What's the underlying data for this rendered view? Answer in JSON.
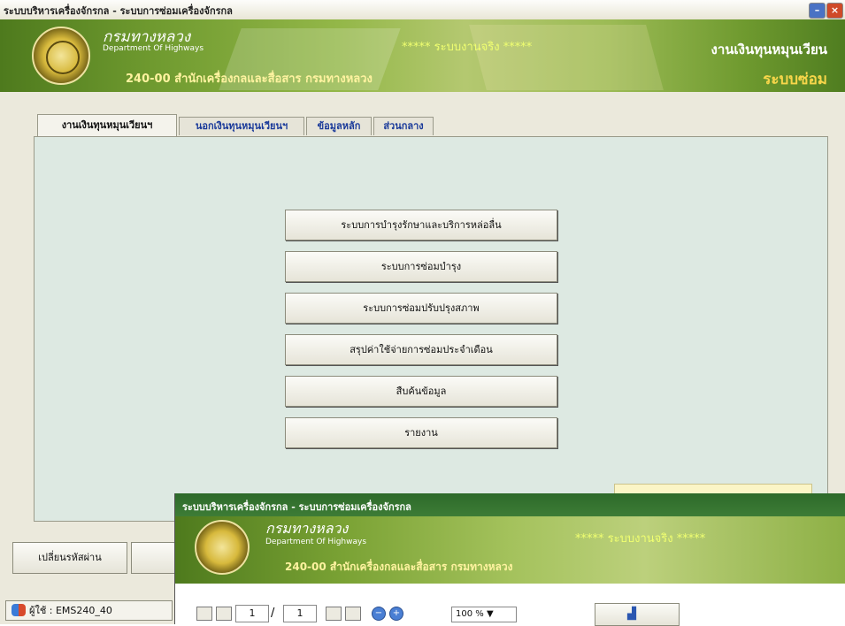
{
  "window": {
    "title": "ระบบบริหารเครื่องจักรกล - ระบบการซ่อมเครื่องจักรกล",
    "minimize_icon": "minimize-icon",
    "close_icon": "close-icon"
  },
  "banner": {
    "org_th": "กรมทางหลวง",
    "org_en": "Department Of Highways",
    "office": "240-00 สำนักเครื่องกลและสื่อสาร กรมทางหลวง",
    "real_system": "***** ระบบงานจริง *****",
    "fund": "งานเงินทุนหมุนเวียน",
    "system": "ระบบซ่อม"
  },
  "tabs": [
    {
      "label": "งานเงินทุนหมุนเวียนฯ"
    },
    {
      "label": "นอกเงินทุนหมุนเวียนฯ"
    },
    {
      "label": "ข้อมูลหลัก"
    },
    {
      "label": "ส่วนกลาง"
    }
  ],
  "menu": [
    {
      "label": "ระบบการบำรุงรักษาและบริการหล่อลื่น"
    },
    {
      "label": "ระบบการซ่อมบำรุง"
    },
    {
      "label": "ระบบการซ่อมปรับปรุงสภาพ"
    },
    {
      "label": "สรุปค่าใช้จ่ายการซ่อมประจำเดือน"
    },
    {
      "label": "สืบค้นข้อมูล"
    },
    {
      "label": "รายงาน"
    }
  ],
  "footer": {
    "change_password": "เปลี่ยนรหัสผ่าน",
    "status_user": "ผู้ใช้ : EMS240_40"
  },
  "report_window": {
    "title": "ระบบบริหารเครื่องจักรกล - ระบบการซ่อมเครื่องจักรกล",
    "org_th": "กรมทางหลวง",
    "org_en": "Department Of Highways",
    "office": "240-00 สำนักเครื่องกลและสื่อสาร กรมทางหลวง",
    "real_system": "***** ระบบงานจริง *****",
    "page_current": "1",
    "page_sep": "/",
    "page_total": "1",
    "zoom": "100 %"
  }
}
